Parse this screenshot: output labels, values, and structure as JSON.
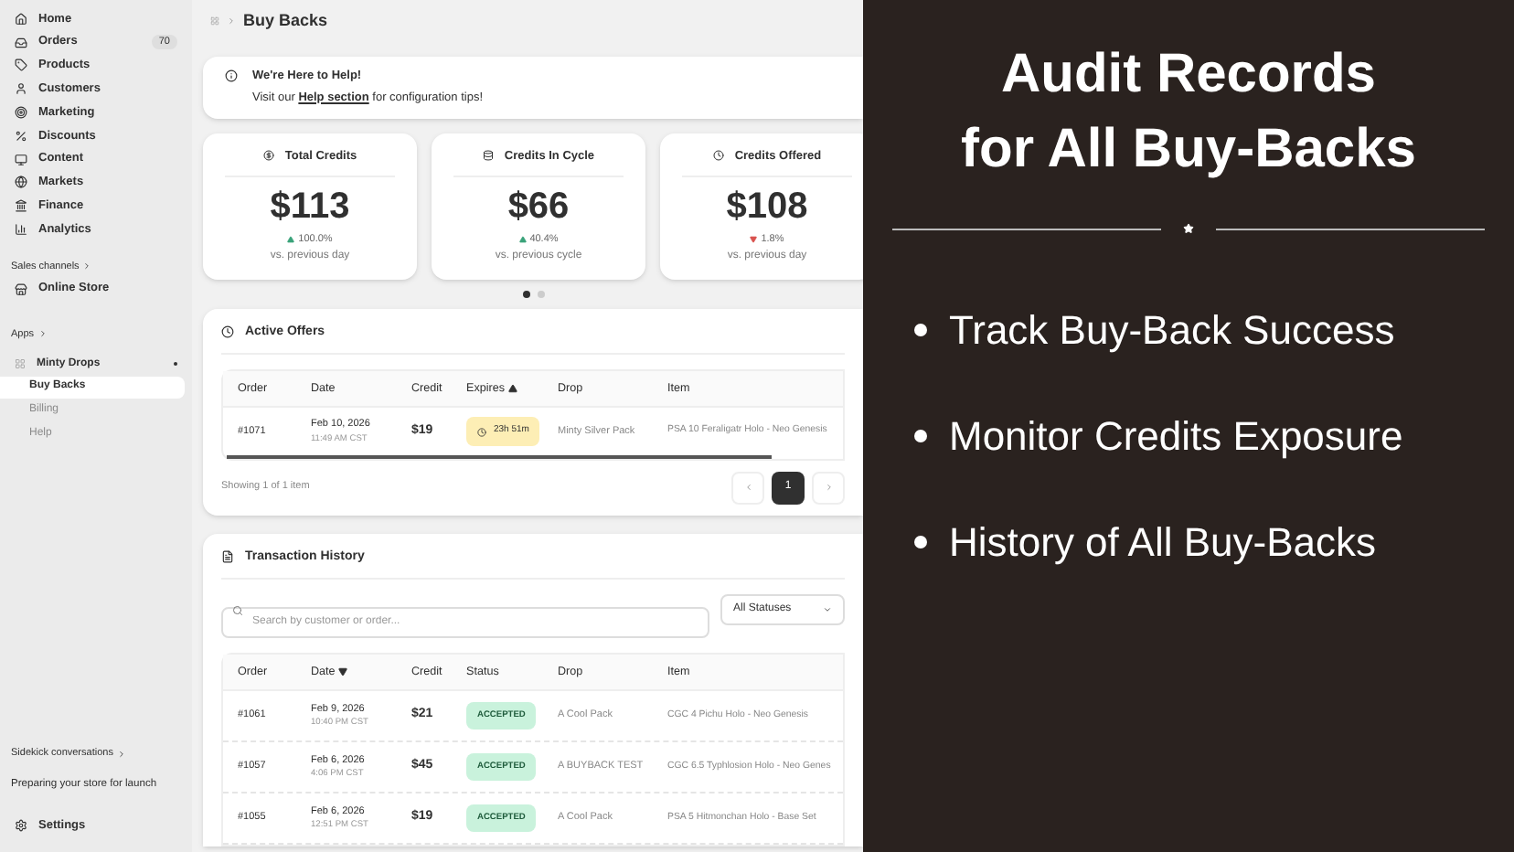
{
  "sidebar": {
    "items": [
      {
        "label": "Home",
        "selected": false
      },
      {
        "label": "Orders",
        "badge": "70",
        "selected": false
      },
      {
        "label": "Products",
        "selected": false
      },
      {
        "label": "Customers",
        "selected": false
      },
      {
        "label": "Marketing",
        "selected": false
      },
      {
        "label": "Discounts",
        "selected": false
      },
      {
        "label": "Content",
        "selected": false
      },
      {
        "label": "Markets",
        "selected": false
      },
      {
        "label": "Finance",
        "selected": false
      },
      {
        "label": "Analytics",
        "selected": false
      }
    ],
    "sales_channels": {
      "heading": "Sales channels",
      "items": [
        {
          "label": "Online Store"
        }
      ]
    },
    "apps": {
      "heading": "Apps",
      "app": {
        "label": "Minty Drops",
        "children": [
          {
            "label": "Buy Backs",
            "selected": true
          },
          {
            "label": "Billing",
            "selected": false
          },
          {
            "label": "Help",
            "selected": false
          }
        ]
      }
    },
    "sidekick": "Sidekick conversations",
    "preparing": "Preparing your store for launch",
    "settings": "Settings"
  },
  "breadcrumb": {
    "title": "Buy Backs"
  },
  "help_banner": {
    "title": "We're Here to Help!",
    "link": "Help section",
    "before": "Visit our",
    "after": "for configuration tips!"
  },
  "stats": [
    {
      "title": "Total Credits",
      "value": "$113",
      "change": "100.0%",
      "rising": true,
      "compare": "vs. previous day"
    },
    {
      "title": "Credits In Cycle",
      "value": "$66",
      "change": "40.4%",
      "rising": true,
      "compare": "vs. previous cycle"
    },
    {
      "title": "Credits Offered",
      "value": "$108",
      "change": "1.8%",
      "rising": false,
      "compare": "vs. previous day"
    }
  ],
  "carousel_dots": [
    {
      "selected": true
    },
    {
      "selected": false
    }
  ],
  "active_offers": {
    "title": "Active Offers",
    "columns": [
      {
        "label": "Order"
      },
      {
        "label": "Date"
      },
      {
        "label": "Credit"
      },
      {
        "label": "Expires",
        "sorted": true,
        "descending": false
      },
      {
        "label": "Drop"
      },
      {
        "label": "Item"
      }
    ],
    "rows": [
      {
        "order": "#1071",
        "date": "Feb 10, 2026",
        "time": "11:49 AM CST",
        "credit": "$19",
        "expires": "23h 51m",
        "drop": "Minty Silver Pack",
        "item": "PSA 10 Feraligatr Holo - Neo Genesis"
      }
    ],
    "footer": "Showing 1 of 1 item",
    "pages": [
      {
        "label": "1",
        "selected": true
      }
    ]
  },
  "transaction_history": {
    "title": "Transaction History",
    "search": {
      "placeholder": "Search by customer or order..."
    },
    "filter": "All Statuses",
    "columns": [
      {
        "label": "Order"
      },
      {
        "label": "Date",
        "sorted": true,
        "descending": true
      },
      {
        "label": "Credit"
      },
      {
        "label": "Status"
      },
      {
        "label": "Drop"
      },
      {
        "label": "Item"
      }
    ],
    "rows": [
      {
        "order": "#1061",
        "date": "Feb 9, 2026",
        "time": "10:40 PM CST",
        "credit": "$21",
        "status": "ACCEPTED",
        "drop": "A Cool Pack",
        "item": "CGC 4 Pichu Holo - Neo Genesis"
      },
      {
        "order": "#1057",
        "date": "Feb 6, 2026",
        "time": "4:06 PM CST",
        "credit": "$45",
        "status": "ACCEPTED",
        "drop": "A BUYBACK TEST",
        "item": "CGC 6.5 Typhlosion Holo - Neo Genes"
      },
      {
        "order": "#1055",
        "date": "Feb 6, 2026",
        "time": "12:51 PM CST",
        "credit": "$19",
        "status": "ACCEPTED",
        "drop": "A Cool Pack",
        "item": "PSA 5 Hitmonchan Holo - Base Set"
      }
    ]
  },
  "promo": {
    "title_lines": [
      "Audit Records",
      "for All Buy-Backs"
    ],
    "bullets": [
      "Track Buy-Back Success",
      "Monitor Credits Exposure",
      "History of All Buy-Backs"
    ]
  }
}
